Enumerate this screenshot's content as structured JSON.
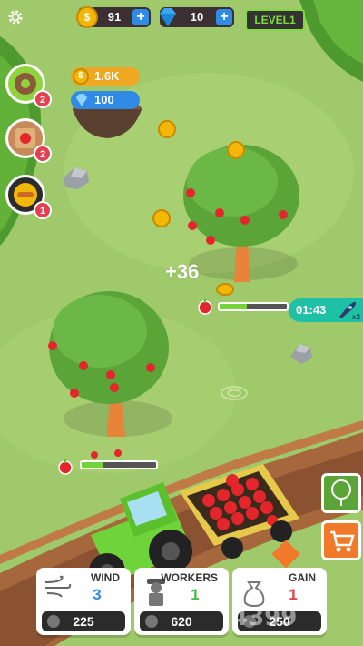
{
  "hud": {
    "coins": "91",
    "gems": "10",
    "level": "LEVEL1",
    "coin_symbol": "$"
  },
  "orders": [
    {
      "item": "donut-icon",
      "badge": "2"
    },
    {
      "item": "apple-crate-icon",
      "badge": "2"
    },
    {
      "item": "sandwich-icon",
      "badge": "1"
    }
  ],
  "island": {
    "coins": "1.6K",
    "gems": "100"
  },
  "floating_text": "+36",
  "timer": "01:43",
  "rocket_badge": "x2",
  "upgrades": [
    {
      "title": "WIND",
      "level": "3",
      "price": "225",
      "level_color": "#2f8be6"
    },
    {
      "title": "WORKERS",
      "level": "1",
      "price": "620",
      "level_color": "#4cb848"
    },
    {
      "title": "GAIN",
      "level": "1",
      "price": "250",
      "level_color": "#e4404f"
    }
  ],
  "watermark": "4399",
  "colors": {
    "grass": "#9fc96a",
    "accent_blue": "#2f8be6",
    "level_green": "#7fdc3a",
    "timer_teal": "#1ec1a4"
  }
}
